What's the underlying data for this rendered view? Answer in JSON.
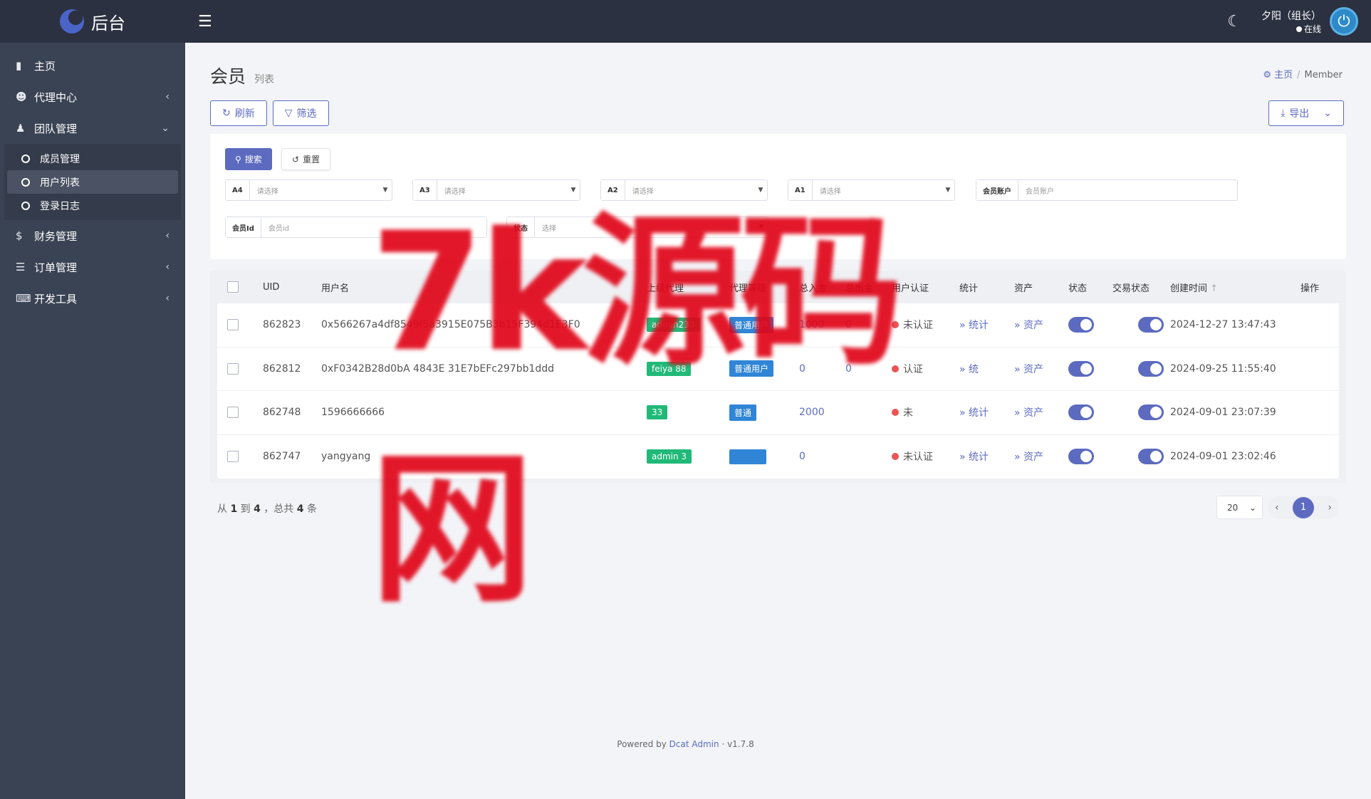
{
  "app": {
    "brand": "后台"
  },
  "sidebar": {
    "items": [
      {
        "label": "主页",
        "icon": "bar-chart-icon",
        "has_children": false
      },
      {
        "label": "代理中心",
        "icon": "user-icon",
        "has_children": true,
        "expanded": false
      },
      {
        "label": "团队管理",
        "icon": "team-icon",
        "has_children": true,
        "expanded": true,
        "children": [
          {
            "label": "成员管理",
            "active": false
          },
          {
            "label": "用户列表",
            "active": true
          },
          {
            "label": "登录日志",
            "active": false
          }
        ]
      },
      {
        "label": "财务管理",
        "icon": "dollar-icon",
        "has_children": true,
        "expanded": false
      },
      {
        "label": "订单管理",
        "icon": "list-icon",
        "has_children": true,
        "expanded": false
      },
      {
        "label": "开发工具",
        "icon": "keyboard-icon",
        "has_children": true,
        "expanded": false
      }
    ]
  },
  "topbar": {
    "user_name": "夕阳（组长）",
    "user_status": "在线"
  },
  "page": {
    "title": "会员",
    "subtitle": "列表",
    "breadcrumb": [
      "主页",
      "Member"
    ]
  },
  "toolbar": {
    "refresh_label": "刷新",
    "filter_label": "筛选",
    "export_label": "导出"
  },
  "filter": {
    "search_label": "搜索",
    "reset_label": "重置",
    "selects": [
      {
        "label": "A4",
        "placeholder": "请选择"
      },
      {
        "label": "A3",
        "placeholder": "请选择"
      },
      {
        "label": "A2",
        "placeholder": "请选择"
      },
      {
        "label": "A1",
        "placeholder": "请选择"
      },
      {
        "label": "会员账户",
        "placeholder": "会员账户"
      },
      {
        "label": "会员Id",
        "placeholder": "会员id"
      },
      {
        "label": "状态",
        "placeholder": "选择"
      }
    ]
  },
  "table": {
    "columns": [
      "UID",
      "用户名",
      "上级代理",
      "代理等级",
      "总入金",
      "总出金",
      "用户认证",
      "统计",
      "资产",
      "状态",
      "交易状态",
      "创建时间",
      "操作"
    ],
    "rows": [
      {
        "uid": "862823",
        "username": "0x566267a4df8549f5a3915E075B3b15F394d1E3F0",
        "agent": "admin233",
        "level": "普通用户",
        "deposit": "1000",
        "withdraw": "0",
        "auth": "未认证",
        "stats": "统计",
        "assets": "资产",
        "status": true,
        "trade_status": true,
        "created": "2024-12-27 13:47:43"
      },
      {
        "uid": "862812",
        "username": "0xF0342B28d0bA  4843E  31E7bEFc297bb1ddd",
        "agent": "feiya  88",
        "level": "普通用户",
        "deposit": "0",
        "withdraw": "0",
        "auth": "认证",
        "stats": "统",
        "assets": "资产",
        "status": true,
        "trade_status": true,
        "created": "2024-09-25 11:55:40"
      },
      {
        "uid": "862748",
        "username": "1596666666",
        "agent": "33",
        "level": "普通",
        "deposit": "2000",
        "withdraw": "",
        "auth": "未",
        "stats": "统计",
        "assets": "资产",
        "status": true,
        "trade_status": true,
        "created": "2024-09-01 23:07:39"
      },
      {
        "uid": "862747",
        "username": "yangyang",
        "agent": "admin  3",
        "level": "",
        "deposit": "0",
        "withdraw": "",
        "auth": "未认证",
        "stats": "统计",
        "assets": "资产",
        "status": true,
        "trade_status": true,
        "created": "2024-09-01 23:02:46"
      }
    ]
  },
  "pagination": {
    "from": "1",
    "to": "4",
    "total": "4",
    "per_page": "20",
    "current": "1"
  },
  "footer": {
    "powered_prefix": "Powered by",
    "powered_link": "Dcat Admin",
    "version": "v1.7.8"
  },
  "watermark": "7k源码网"
}
